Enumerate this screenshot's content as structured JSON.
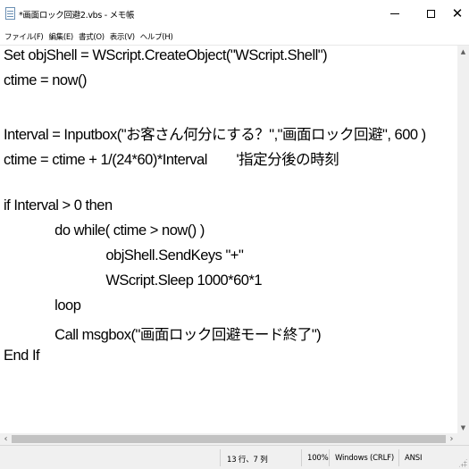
{
  "window": {
    "title": "*画面ロック回避2.vbs - メモ帳",
    "controls": {
      "minimize": "—",
      "maximize": "☐",
      "close": "✕"
    }
  },
  "menu": [
    {
      "label": "ファイル(F)"
    },
    {
      "label": "編集(E)"
    },
    {
      "label": "書式(O)"
    },
    {
      "label": "表示(V)"
    },
    {
      "label": "ヘルプ(H)"
    }
  ],
  "editor": {
    "lines": [
      "Set objShell = WScript.CreateObject(\"WScript.Shell\")",
      "ctime = now()",
      "",
      "Interval = Inputbox(\"お客さん何分にする？\",\"画面ロック回避\", 600 )",
      "ctime = ctime + 1/(24*60)*Interval        '指定分後の時刻",
      "",
      "if Interval > 0 then",
      "              do while( ctime > now() )",
      "                            objShell.SendKeys \"+\"",
      "                            WScript.Sleep 1000*60*1",
      "              loop",
      "              Call msgbox(\"画面ロック回避モード終了\")",
      "End If"
    ]
  },
  "scrollbars": {
    "up_arrow": "▲",
    "down_arrow": "▼",
    "left_arrow": "‹",
    "right_arrow": "›"
  },
  "status": {
    "position": "13 行、7 列",
    "zoom": "100%",
    "line_ending": "Windows (CRLF)",
    "encoding": "ANSI"
  }
}
